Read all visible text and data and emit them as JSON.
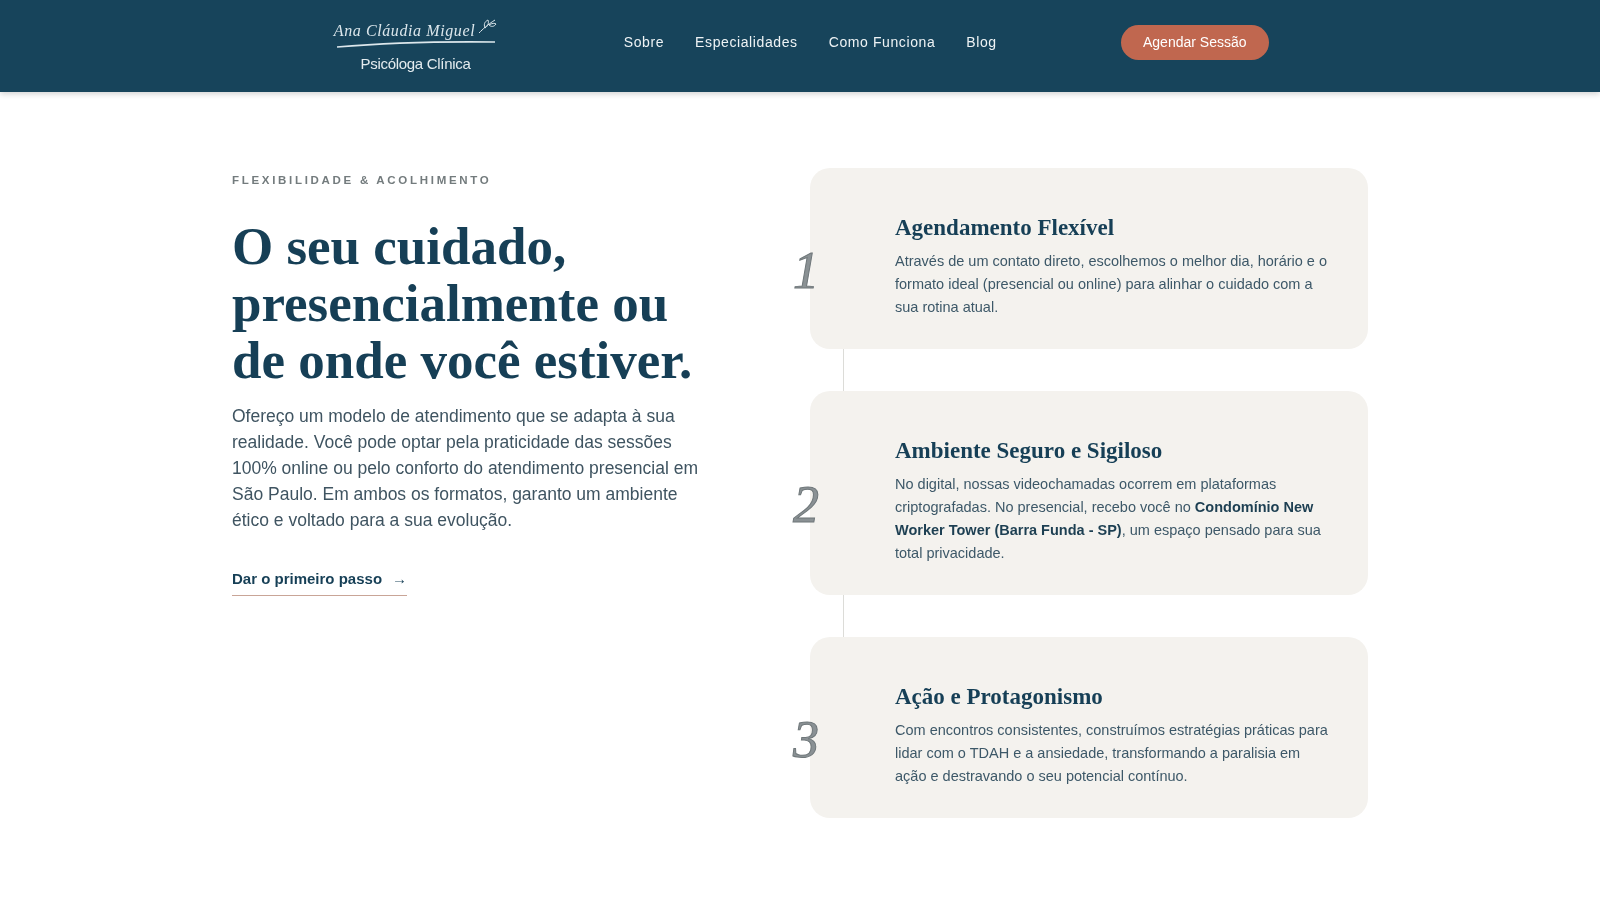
{
  "header": {
    "logo": {
      "script": "Ana Cláudia Miguel",
      "subtitle": "Psicóloga Clínica"
    },
    "nav": [
      "Sobre",
      "Especialidades",
      "Como Funciona",
      "Blog"
    ],
    "cta": "Agendar Sessão"
  },
  "hero": {
    "eyebrow": "FLEXIBILIDADE & ACOLHIMENTO",
    "heading": "O seu cuidado, presencialmente ou de onde você estiver.",
    "paragraph": "Ofereço um modelo de atendimento que se adapta à sua realidade. Você pode optar pela praticidade das sessões 100% online ou pelo conforto do atendimento presencial em São Paulo. Em ambos os formatos, garanto um ambiente ético e voltado para a sua evolução.",
    "link": {
      "label": "Dar o primeiro passo",
      "arrow": "→"
    }
  },
  "steps": [
    {
      "number": "1",
      "title": "Agendamento Flexível",
      "text": "Através de um contato direto, escolhemos o melhor dia, horário e o formato ideal (presencial ou online) para alinhar o cuidado com a sua rotina atual."
    },
    {
      "number": "2",
      "title": "Ambiente Seguro e Sigiloso",
      "text": "No digital, nossas videochamadas ocorrem em plataformas criptografadas. No presencial, recebo você no **Condomínio New Worker Tower (Barra Funda - SP)**, um espaço pensado para sua total privacidade."
    },
    {
      "number": "3",
      "title": "Ação e Protagonismo",
      "text": "Com encontros consistentes, construímos estratégias práticas para lidar com o TDAH e a ansiedade, transformando a paralisia em ação e destravando o seu potencial contínuo."
    }
  ]
}
